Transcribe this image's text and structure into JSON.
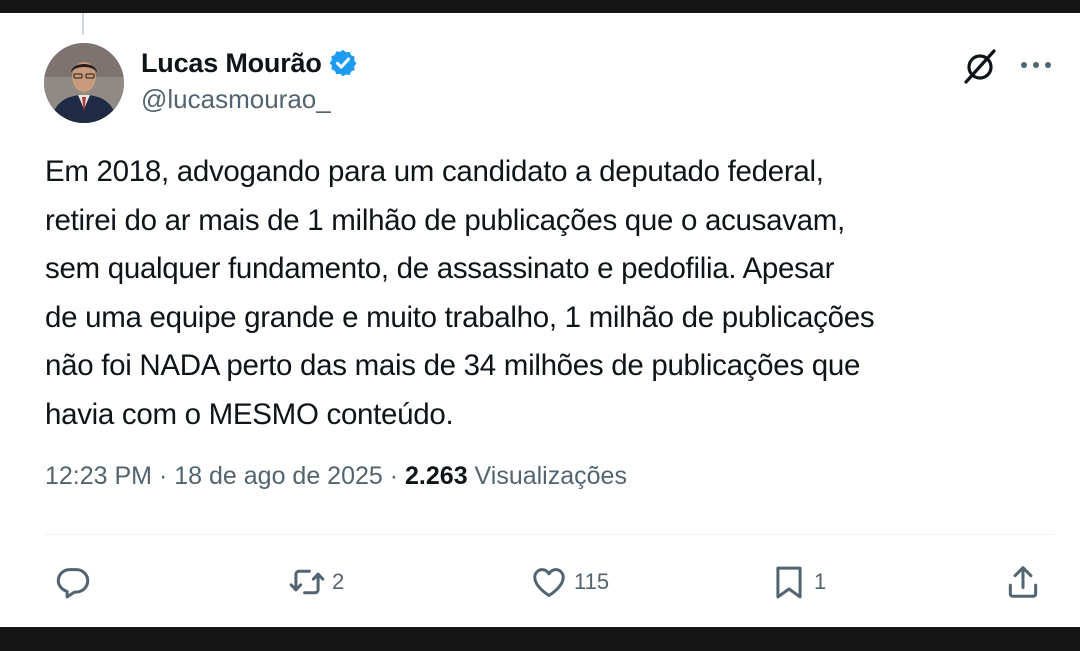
{
  "author": {
    "display_name": "Lucas Mourão",
    "handle": "@lucasmourao_",
    "verified": true,
    "verified_color": "#1d9bf0"
  },
  "tweet": {
    "lines": [
      "Em 2018, advogando para um candidato a deputado federal,",
      "retirei do ar mais de 1 milhão de publicações que o acusavam,",
      "sem qualquer fundamento, de assassinato e pedofilia. Apesar",
      "de uma equipe grande e muito trabalho, 1 milhão de publicações",
      "não foi NADA perto das mais de 34 milhões de publicações que",
      "havia com o MESMO conteúdo."
    ]
  },
  "meta": {
    "time": "12:23 PM",
    "separator": "·",
    "date": "18 de ago de 2025",
    "views_count": "2.263",
    "views_label": "Visualizações"
  },
  "actions": {
    "reply_icon": "reply-icon",
    "retweet_icon": "retweet-icon",
    "retweet_count": "2",
    "like_icon": "heart-icon",
    "like_count": "115",
    "bookmark_icon": "bookmark-icon",
    "bookmark_count": "1",
    "share_icon": "share-icon"
  },
  "colors": {
    "text_primary": "#0f1419",
    "text_secondary": "#536471",
    "accent": "#1d9bf0"
  }
}
